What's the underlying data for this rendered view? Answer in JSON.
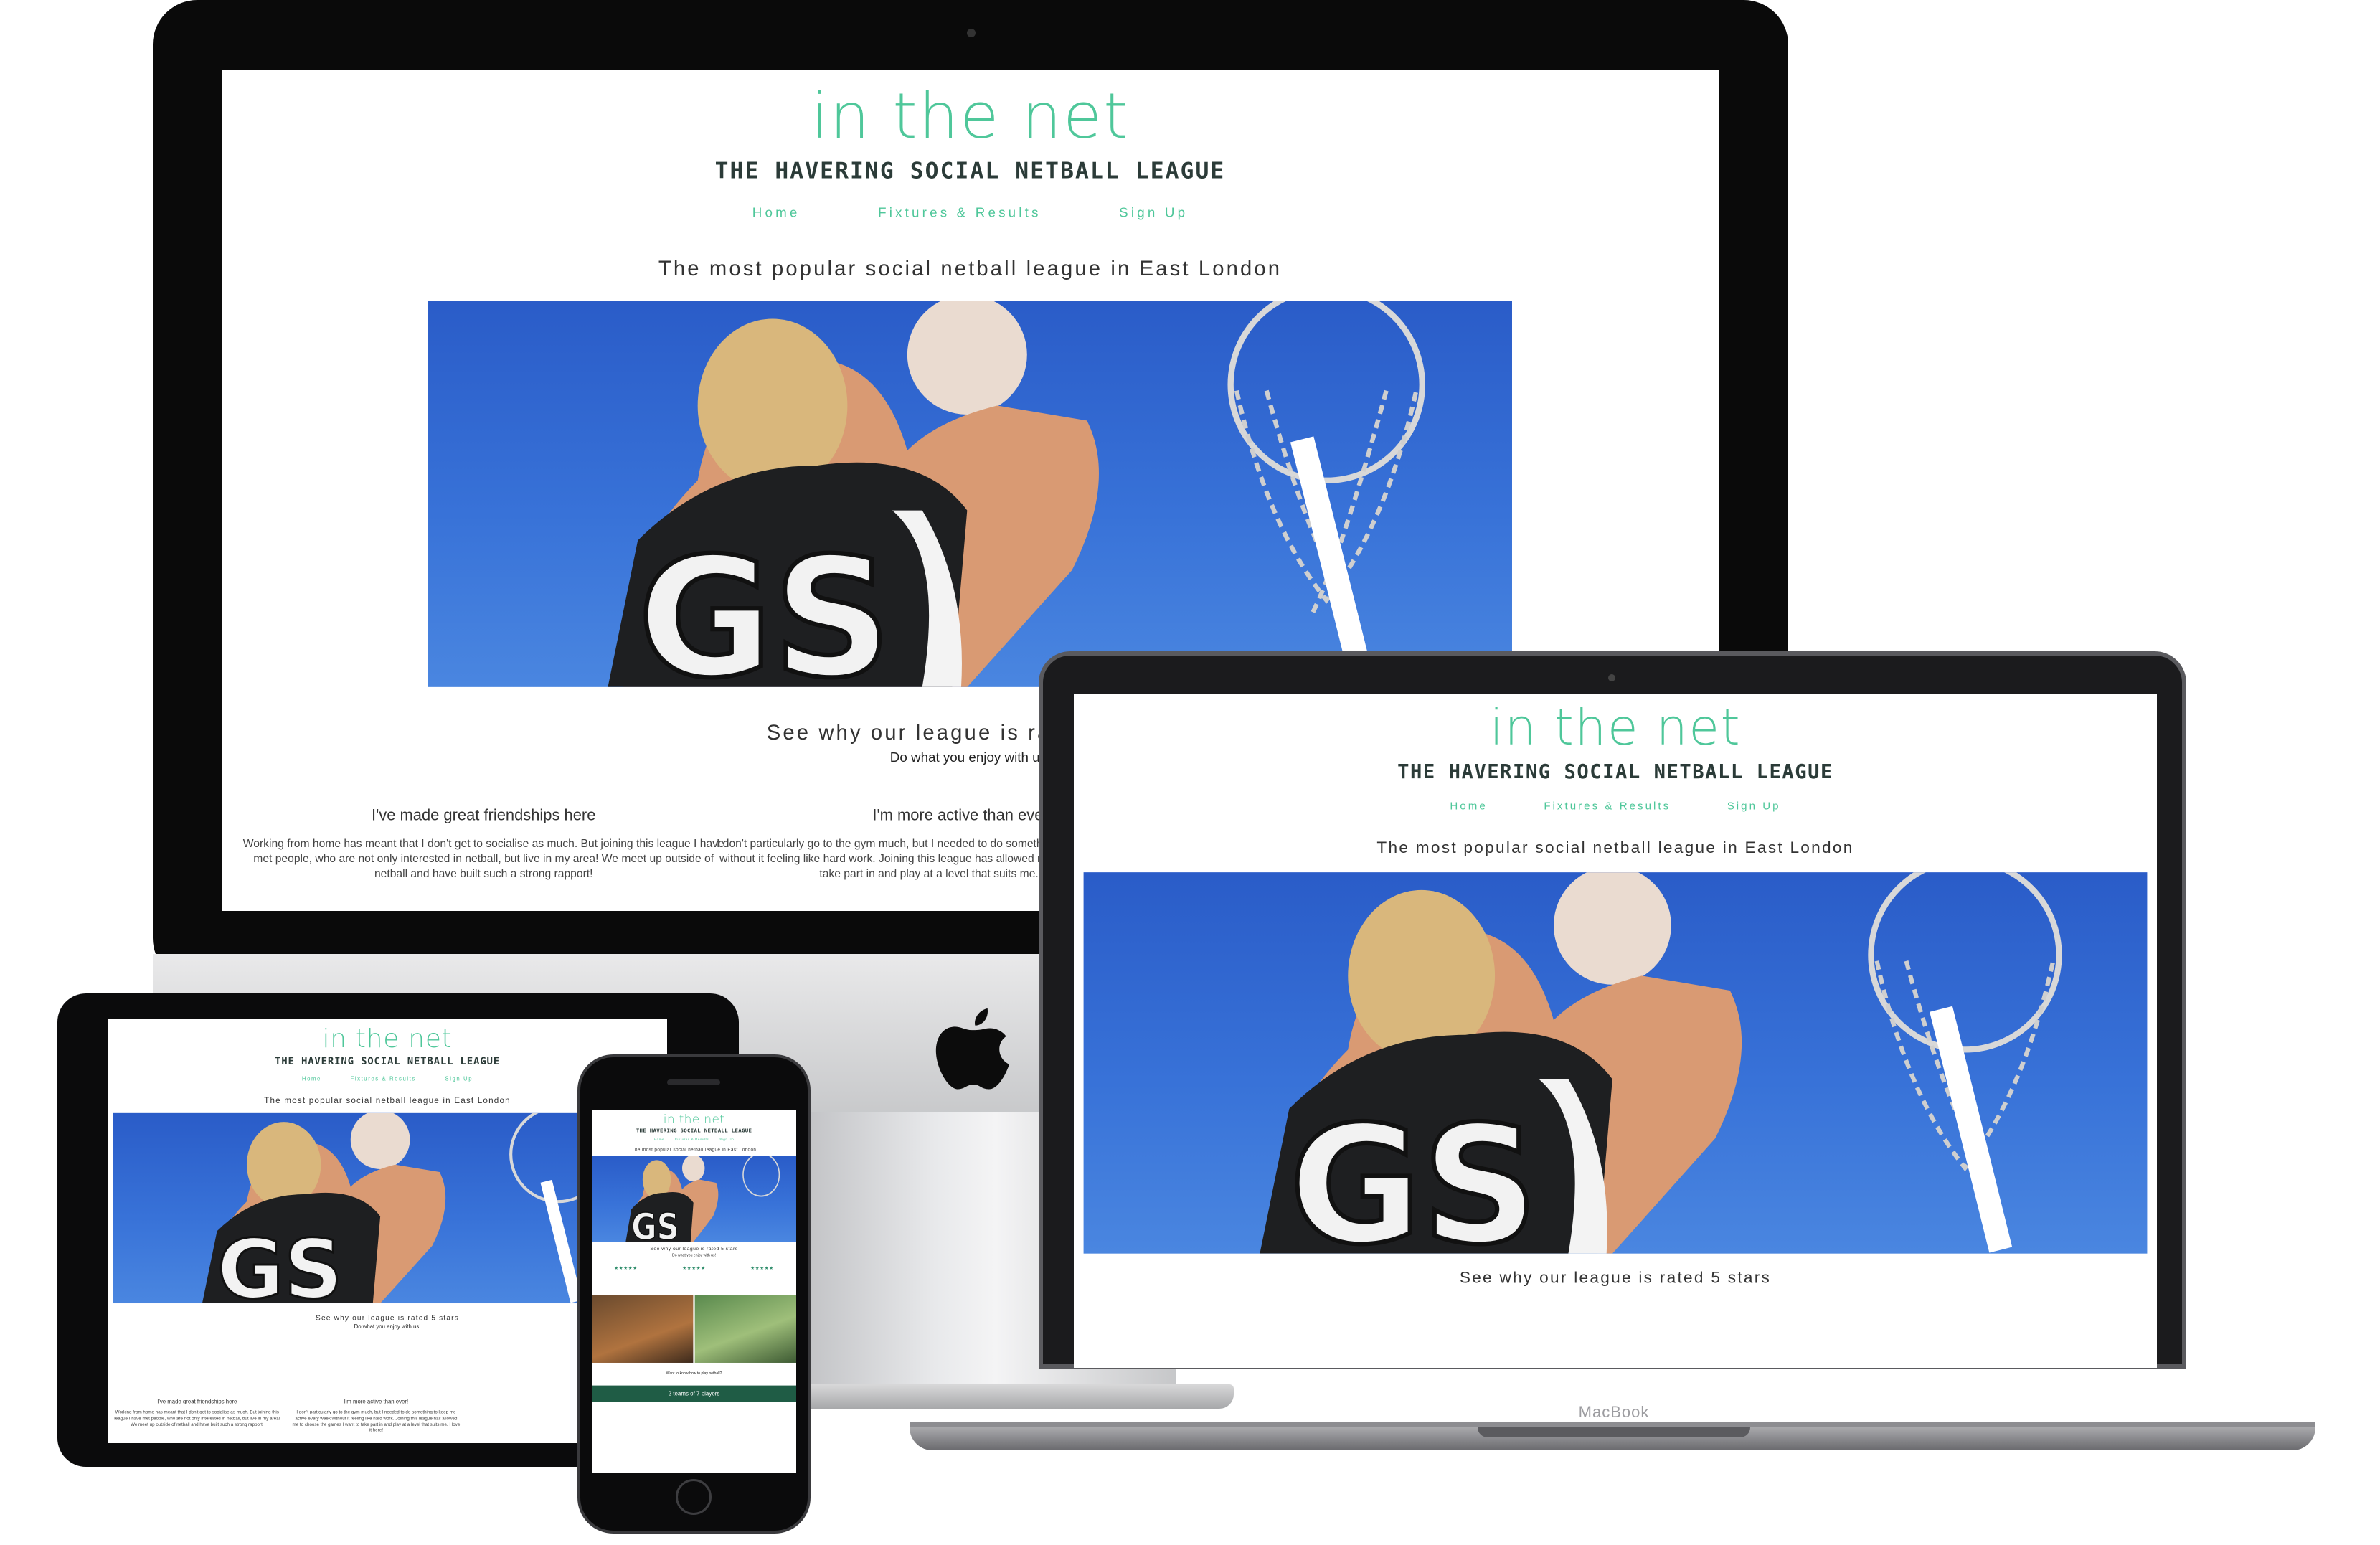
{
  "site": {
    "logo": "in the net",
    "league": "THE HAVERING SOCIAL NETBALL LEAGUE",
    "nav": [
      "Home",
      "Fixtures & Results",
      "Sign Up"
    ],
    "tagline": "The most popular social netball league in East London",
    "stars_title": "See why our league is rated 5 stars",
    "stars_sub": "Do what you enjoy with us!",
    "testimonials": [
      {
        "title": "I've made great friendships here",
        "body": "Working from home has meant that I don't get to socialise as much. But joining this league I have met people, who are not only interested in netball, but live in my area! We meet up outside of netball and have built such a strong rapport!"
      },
      {
        "title": "I'm more active than ever!",
        "body": "I don't particularly go to the gym much, but I needed to do something to keep me active every week without it feeling like hard work. Joining this league has allowed me to choose the games I want to take part in and play at a level that suits me. I love it here!"
      }
    ],
    "stars": "★★★★★",
    "phone_cta": "2 teams of 7 players",
    "phone_want": "Want to know how to play netball?"
  },
  "device": {
    "macbook_label": "MacBook",
    "apple_logo": "apple-logo-icon"
  },
  "colors": {
    "accent": "#4fc79a",
    "sky": "#3872d8"
  }
}
